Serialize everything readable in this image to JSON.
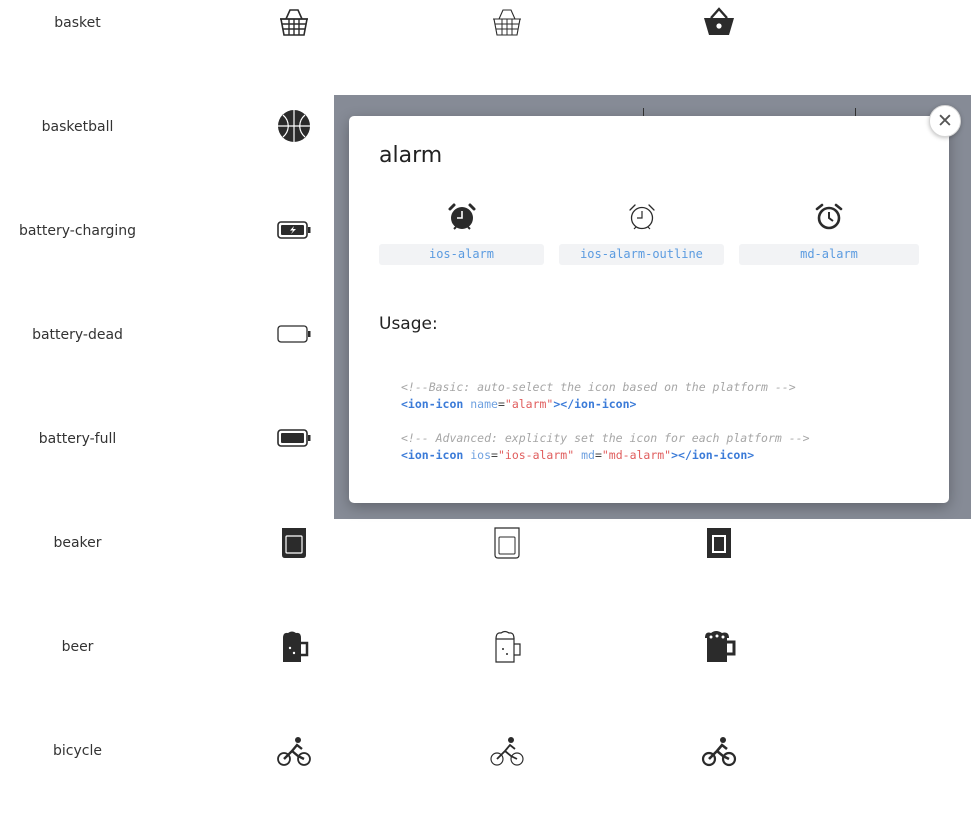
{
  "icon_rows": [
    {
      "name": "basket",
      "icons": [
        "basket-ios-icon",
        "basket-ios-outline-icon",
        "basket-md-icon"
      ]
    },
    {
      "name": "basketball",
      "icons": [
        "basketball-ios-icon",
        "basketball-ios-outline-icon",
        "basketball-md-icon"
      ]
    },
    {
      "name": "battery-charging",
      "icons": [
        "battery-charging-ios-icon",
        "battery-charging-ios-outline-icon",
        "battery-charging-md-icon"
      ]
    },
    {
      "name": "battery-dead",
      "icons": [
        "battery-dead-ios-icon",
        "battery-dead-ios-outline-icon",
        "battery-dead-md-icon"
      ]
    },
    {
      "name": "battery-full",
      "icons": [
        "battery-full-ios-icon",
        "battery-full-ios-outline-icon",
        "battery-full-md-icon"
      ]
    },
    {
      "name": "beaker",
      "icons": [
        "beaker-ios-icon",
        "beaker-ios-outline-icon",
        "beaker-md-icon"
      ]
    },
    {
      "name": "beer",
      "icons": [
        "beer-ios-icon",
        "beer-ios-outline-icon",
        "beer-md-icon"
      ]
    },
    {
      "name": "bicycle",
      "icons": [
        "bicycle-ios-icon",
        "bicycle-ios-outline-icon",
        "bicycle-md-icon"
      ]
    }
  ],
  "modal": {
    "title": "alarm",
    "variants": [
      {
        "label": "ios-alarm",
        "icon": "alarm-filled-icon"
      },
      {
        "label": "ios-alarm-outline",
        "icon": "alarm-outline-icon"
      },
      {
        "label": "md-alarm",
        "icon": "alarm-md-icon"
      }
    ],
    "usage_label": "Usage:",
    "close_icon": "close-icon",
    "code": {
      "basic_comment": "<!--Basic: auto-select the icon based on the platform -->",
      "basic_tag_open": "<ion-icon",
      "basic_attr_name": "name",
      "basic_attr_value": "\"alarm\"",
      "basic_tag_close": "></ion-icon>",
      "advanced_comment": "<!-- Advanced: explicity set the icon for each platform -->",
      "adv_tag_open": "<ion-icon",
      "adv_attr_ios": "ios",
      "adv_val_ios": "\"ios-alarm\"",
      "adv_attr_md": "md",
      "adv_val_md": "\"md-alarm\"",
      "adv_tag_close": "></ion-icon>",
      "equals": "="
    }
  },
  "colors": {
    "icon": "#2b2b2b",
    "backdrop": "#868b96",
    "chip_text": "#5b9be0"
  }
}
